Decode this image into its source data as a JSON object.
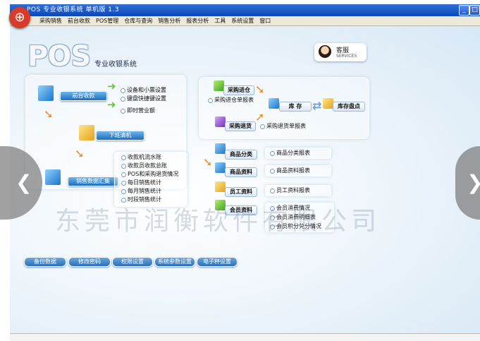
{
  "window": {
    "title": "POS 专业收银系统 单机版 1.3",
    "minimize_glyph": "_",
    "maximize_glyph": "□"
  },
  "menu": [
    "采购销售",
    "前台收款",
    "POS管理",
    "仓库与查询",
    "销售分析",
    "报表分析",
    "工具",
    "系统设置",
    "窗口"
  ],
  "brand": {
    "logo": "POS",
    "subtitle": "专业收银系统"
  },
  "service": {
    "cn": "客服",
    "en": "SERVICES"
  },
  "left_panel": {
    "front_checkout": "前台收款",
    "front_items": [
      "设备和小票设置",
      "键盘快捷键设置",
      "即时营业额"
    ],
    "shift_handover": "下班清机",
    "sales_summary": "销售数据汇集",
    "summary_items": [
      "收款机流水账",
      "收款员收款总账",
      "POS和采购退货情况",
      "每日销售统计",
      "每月销售统计",
      "时段销售统计"
    ]
  },
  "right_panel": {
    "purchase_in": "采购进仓",
    "purchase_in_report": "采购进仓单报表",
    "stock": "库 存",
    "stock_check": "库存盘点",
    "purchase_return": "采购退货",
    "purchase_return_report": "采购退货单报表"
  },
  "modules": [
    {
      "label": "商品分类",
      "reports": [
        "商品分类报表"
      ]
    },
    {
      "label": "商品资料",
      "reports": [
        "商品资料报表"
      ]
    },
    {
      "label": "员工资料",
      "reports": [
        "员工资料报表"
      ]
    },
    {
      "label": "会员资料",
      "reports": [
        "会员消费情况",
        "会员消费明细表",
        "会员积分兑分情况"
      ]
    }
  ],
  "bottom_buttons": [
    "备份数据",
    "修改密码",
    "权限设置",
    "系统参数设置",
    "电子秤设置"
  ],
  "watermark": "东莞市润衡软件有限公司",
  "carousel": {
    "prev": "❮",
    "next": "❯"
  },
  "icons": {
    "app": "app-icon",
    "person": "person-icon",
    "cube": "cube-icon",
    "arrow": "arrow-icon"
  },
  "colors": {
    "titlebar": "#1f5fd0",
    "button": "#2f82d6",
    "arrow": "#f08a1c"
  }
}
